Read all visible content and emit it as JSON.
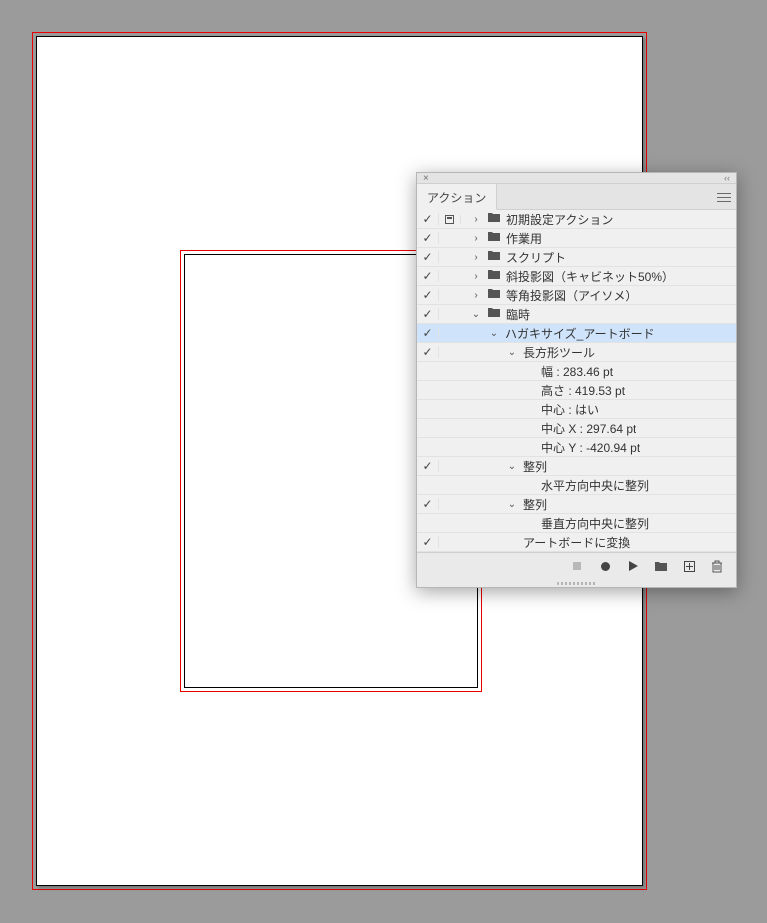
{
  "panel": {
    "title_tab": "アクション",
    "rows": [
      {
        "check": true,
        "mode": "dialog",
        "indent": 0,
        "chev": "right",
        "folder": true,
        "label": "初期設定アクション",
        "selected": false
      },
      {
        "check": true,
        "mode": "",
        "indent": 0,
        "chev": "right",
        "folder": true,
        "label": "作業用",
        "selected": false
      },
      {
        "check": true,
        "mode": "",
        "indent": 0,
        "chev": "right",
        "folder": true,
        "label": "スクリプト",
        "selected": false
      },
      {
        "check": true,
        "mode": "",
        "indent": 0,
        "chev": "right",
        "folder": true,
        "label": "斜投影図（キャビネット50%）",
        "selected": false
      },
      {
        "check": true,
        "mode": "",
        "indent": 0,
        "chev": "right",
        "folder": true,
        "label": "等角投影図（アイソメ）",
        "selected": false
      },
      {
        "check": true,
        "mode": "",
        "indent": 0,
        "chev": "down",
        "folder": true,
        "label": "臨時",
        "selected": false
      },
      {
        "check": true,
        "mode": "",
        "indent": 1,
        "chev": "down",
        "folder": false,
        "label": "ハガキサイズ_アートボード",
        "selected": true
      },
      {
        "check": true,
        "mode": "",
        "indent": 2,
        "chev": "down",
        "folder": false,
        "label": "長方形ツール",
        "selected": false
      },
      {
        "check": false,
        "mode": "",
        "indent": 3,
        "chev": "",
        "folder": false,
        "label": "幅 : 283.46 pt",
        "selected": false
      },
      {
        "check": false,
        "mode": "",
        "indent": 3,
        "chev": "",
        "folder": false,
        "label": "高さ : 419.53 pt",
        "selected": false
      },
      {
        "check": false,
        "mode": "",
        "indent": 3,
        "chev": "",
        "folder": false,
        "label": "中心 : はい",
        "selected": false
      },
      {
        "check": false,
        "mode": "",
        "indent": 3,
        "chev": "",
        "folder": false,
        "label": "中心 X : 297.64 pt",
        "selected": false
      },
      {
        "check": false,
        "mode": "",
        "indent": 3,
        "chev": "",
        "folder": false,
        "label": "中心 Y : -420.94 pt",
        "selected": false
      },
      {
        "check": true,
        "mode": "",
        "indent": 2,
        "chev": "down",
        "folder": false,
        "label": "整列",
        "selected": false
      },
      {
        "check": false,
        "mode": "",
        "indent": 3,
        "chev": "",
        "folder": false,
        "label": "水平方向中央に整列",
        "selected": false
      },
      {
        "check": true,
        "mode": "",
        "indent": 2,
        "chev": "down",
        "folder": false,
        "label": "整列",
        "selected": false
      },
      {
        "check": false,
        "mode": "",
        "indent": 3,
        "chev": "",
        "folder": false,
        "label": "垂直方向中央に整列",
        "selected": false
      },
      {
        "check": true,
        "mode": "",
        "indent": 2,
        "chev": "",
        "folder": false,
        "label": "アートボードに変換",
        "selected": false
      }
    ],
    "footer": {
      "stop": "停止",
      "rec": "記録",
      "play": "再生",
      "folder": "新規セット",
      "new": "新規アクション",
      "trash": "削除"
    }
  }
}
